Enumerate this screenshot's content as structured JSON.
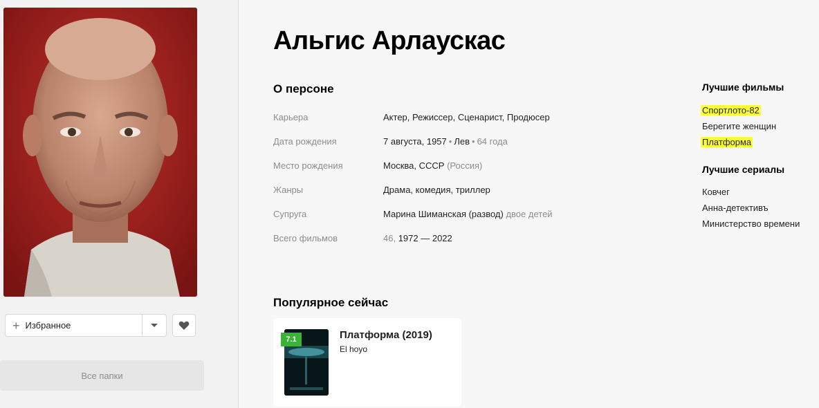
{
  "person": {
    "name": "Альгис Арлаускас"
  },
  "sidebar": {
    "favorites_label": "Избранное",
    "all_folders_label": "Все папки"
  },
  "about": {
    "title": "О персоне",
    "rows": [
      {
        "key": "Карьера",
        "value": "Актер, Режиссер, Сценарист, Продюсер"
      },
      {
        "key": "Дата рождения",
        "value": "7 августа, 1957",
        "sign": "Лев",
        "age": "64 года"
      },
      {
        "key": "Место рождения",
        "value": "Москва, СССР",
        "extra": "(Россия)"
      },
      {
        "key": "Жанры",
        "value": "Драма, комедия, триллер"
      },
      {
        "key": "Супруга",
        "value": "Марина Шиманская (развод)",
        "extra": "двое детей"
      },
      {
        "key": "Всего фильмов",
        "count": "46,",
        "value": "1972 — 2022"
      }
    ]
  },
  "popular": {
    "title": "Популярное сейчас",
    "film": {
      "title": "Платформа (2019)",
      "original": "El hoyo",
      "rating": "7.1",
      "rating_color": "#3bb33b"
    }
  },
  "best_films": {
    "title": "Лучшие фильмы",
    "items": [
      {
        "label": "Спортлото-82",
        "highlighted": true
      },
      {
        "label": "Берегите женщин",
        "highlighted": false
      },
      {
        "label": "Платформа",
        "highlighted": true
      }
    ]
  },
  "best_series": {
    "title": "Лучшие сериалы",
    "items": [
      {
        "label": "Ковчег"
      },
      {
        "label": "Анна-детективъ"
      },
      {
        "label": "Министерство времени"
      }
    ]
  },
  "colors": {
    "highlight": "#fbff3a",
    "muted_text": "#8c8c8c"
  }
}
